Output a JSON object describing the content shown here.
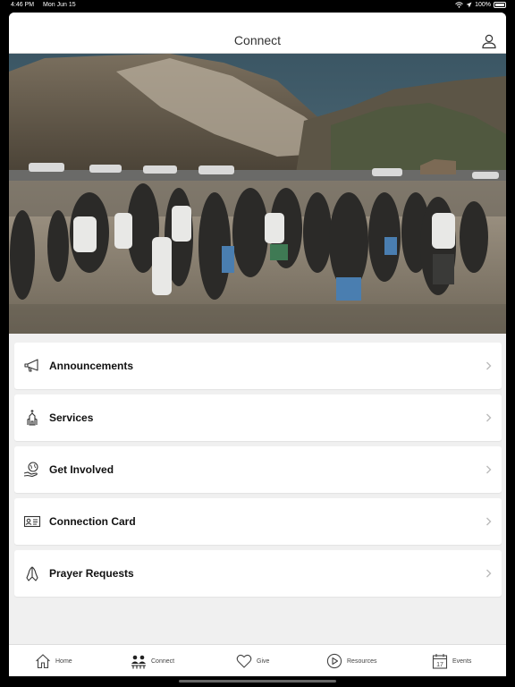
{
  "status": {
    "time": "4:46 PM",
    "date": "Mon Jun 15",
    "battery": "100%"
  },
  "header": {
    "title": "Connect"
  },
  "menu": {
    "items": [
      {
        "label": "Announcements",
        "icon": "megaphone-icon"
      },
      {
        "label": "Services",
        "icon": "church-icon"
      },
      {
        "label": "Get Involved",
        "icon": "globe-hand-icon"
      },
      {
        "label": "Connection Card",
        "icon": "id-card-icon"
      },
      {
        "label": "Prayer Requests",
        "icon": "praying-hands-icon"
      }
    ]
  },
  "tabs": [
    {
      "label": "Home",
      "icon": "home-icon"
    },
    {
      "label": "Connect",
      "icon": "people-icon",
      "active": true
    },
    {
      "label": "Give",
      "icon": "heart-icon"
    },
    {
      "label": "Resources",
      "icon": "play-circle-icon"
    },
    {
      "label": "Events",
      "icon": "calendar-icon",
      "calendar_day": "17"
    }
  ],
  "colors": {
    "accent_text": "#111111",
    "background": "#f0f0f0",
    "sky": "#3f5a68"
  }
}
